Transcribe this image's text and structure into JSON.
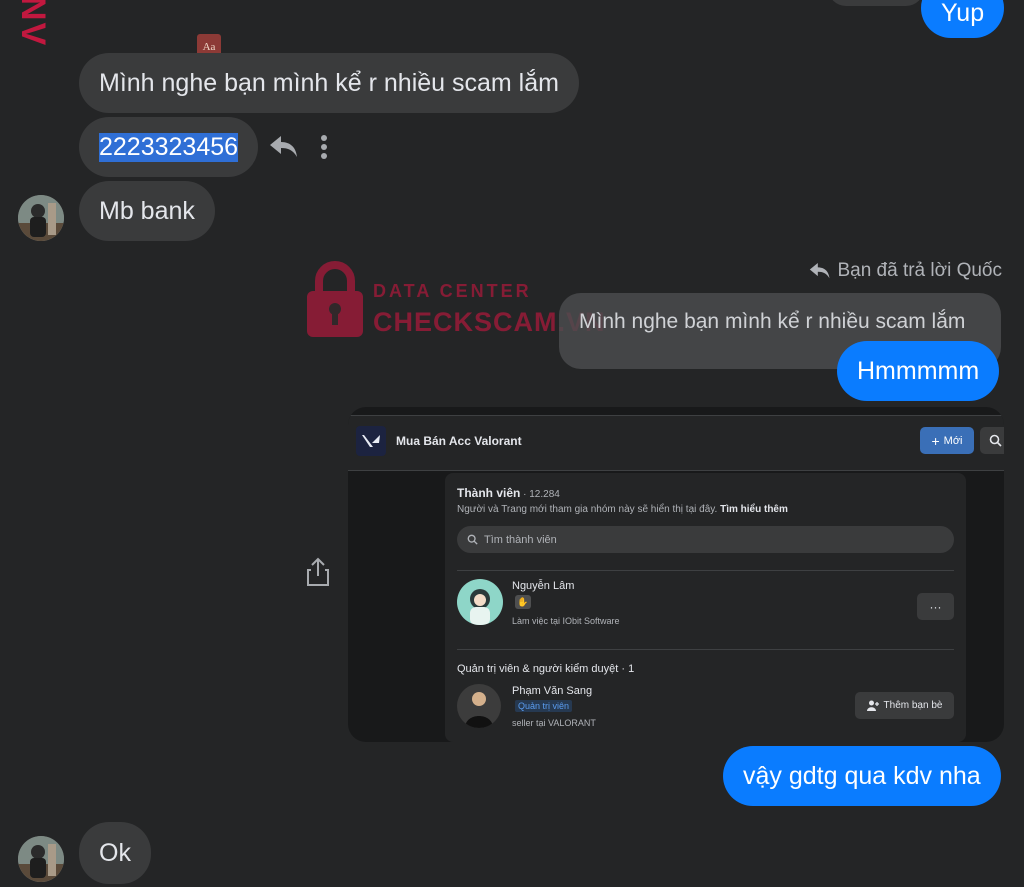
{
  "watermark": {
    "line1": "DATA CENTER",
    "line2": "CHECKSCAM.VN"
  },
  "corner_logo": "NV",
  "messages": {
    "yup": "Yup",
    "scam_msg": "Mình nghe bạn mình kể r nhiều scam lắm",
    "number": "2223323456",
    "mbbank": "Mb bank",
    "reply_header": "Bạn đã trả lời Quốc",
    "reply_quote": "Mình nghe bạn mình kể r nhiều scam lắm",
    "hmm": "Hmmmmm",
    "gdtg": "vậy gdtg qua kdv nha",
    "ok": "Ok"
  },
  "shared_screenshot": {
    "group_name": "Mua Bán Acc Valorant",
    "new_button": "Mới",
    "members_title": "Thành viên",
    "members_count": " · 12.284",
    "members_desc": "Người và Trang mới tham gia nhóm này sẽ hiển thị tại đây.",
    "learn_more": "Tìm hiểu thêm",
    "search_placeholder": "Tìm thành viên",
    "member1_name": "Nguyễn Lâm",
    "member1_work": "Làm việc tại IObit Software",
    "more_btn": "···",
    "admins_title": "Quản trị viên & người kiểm duyệt · 1",
    "admin_name": "Phạm Văn Sang",
    "admin_badge": "Quản trị viên",
    "admin_work": "seller tại VALORANT",
    "add_friend": "Thêm bạn bè"
  },
  "colors": {
    "background": "#242526",
    "incoming_bubble": "#3a3b3c",
    "outgoing_bubble": "#0a7cff",
    "selection": "#2f6fd6",
    "watermark": "#c2183f"
  }
}
